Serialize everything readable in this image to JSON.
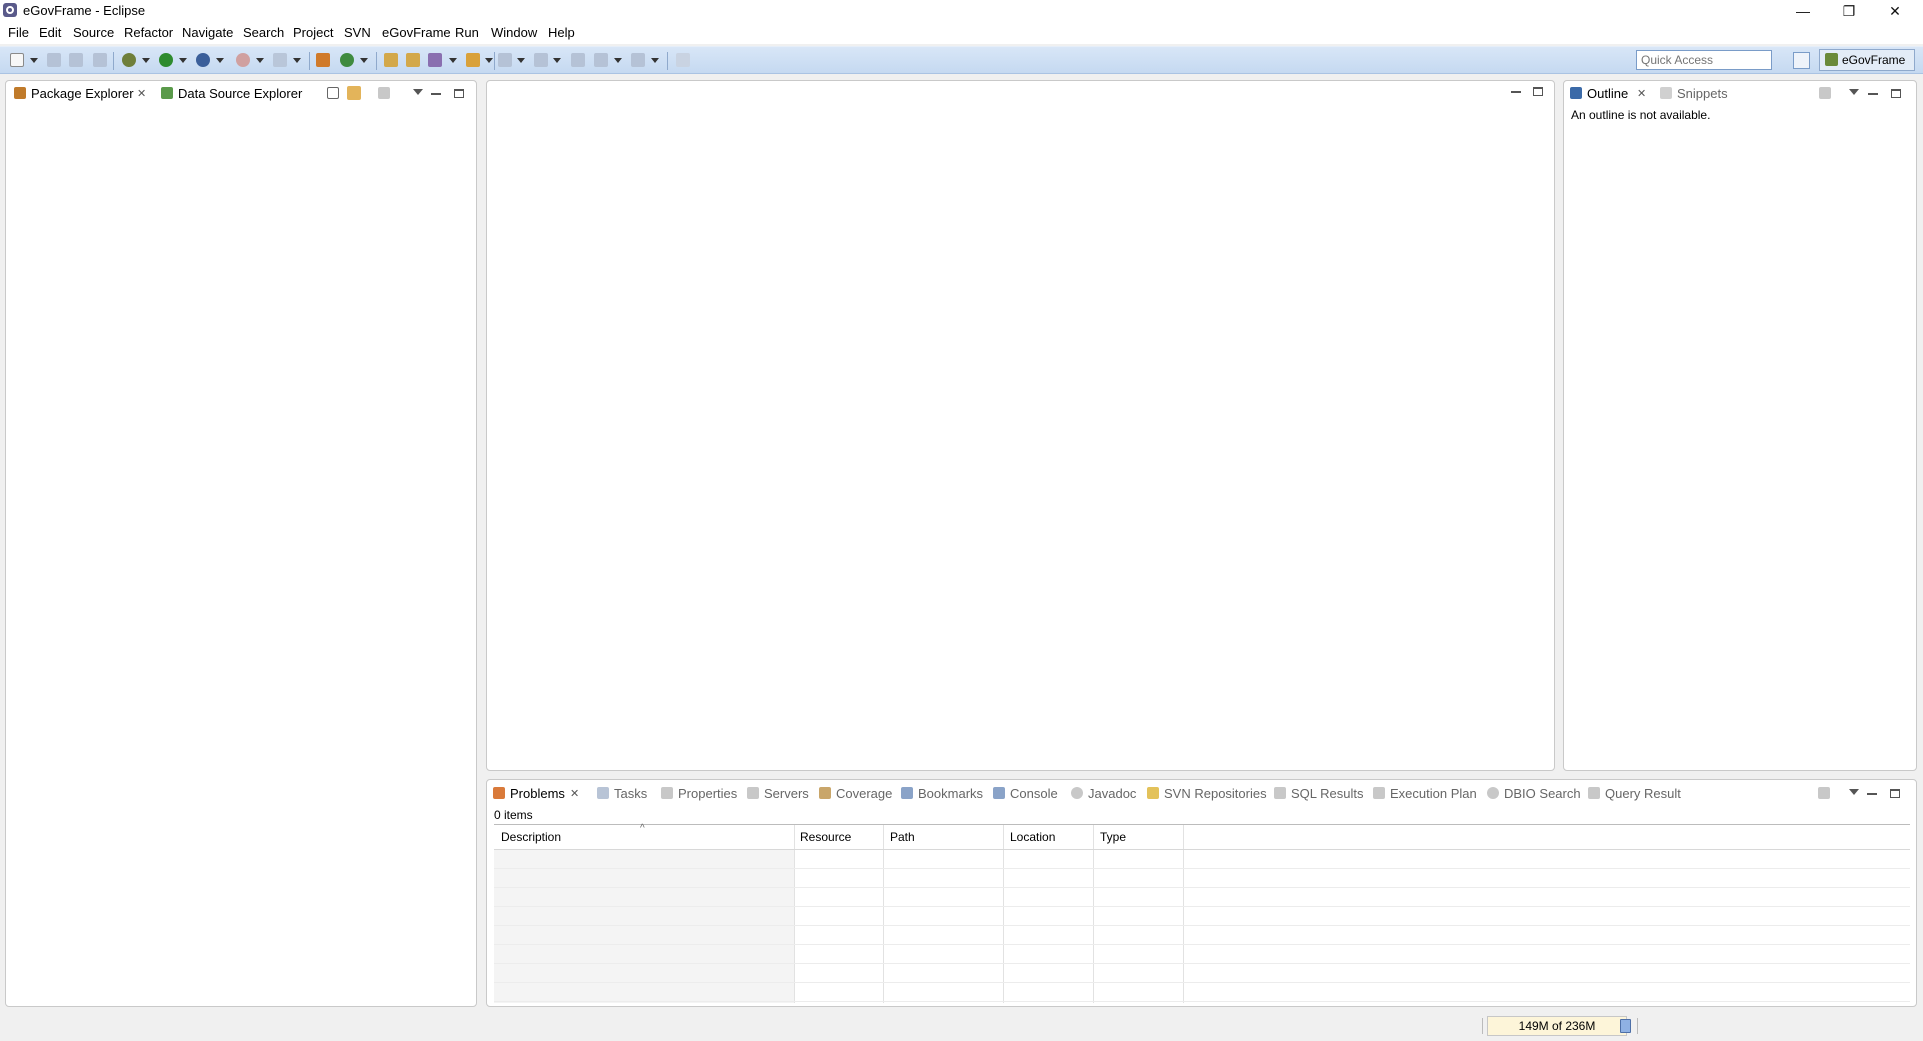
{
  "window": {
    "title": "eGovFrame - Eclipse",
    "controls": {
      "minimize": "—",
      "restore": "❐",
      "close": "✕"
    }
  },
  "menu": [
    "File",
    "Edit",
    "Source",
    "Refactor",
    "Navigate",
    "Search",
    "Project",
    "SVN",
    "eGovFrame",
    "Run",
    "Window",
    "Help"
  ],
  "toolbar": {
    "quick_access_placeholder": "Quick Access",
    "perspective_label": "eGovFrame"
  },
  "left_panel": {
    "tabs": [
      {
        "label": "Package Explorer",
        "icon": "package-explorer-icon",
        "active": true
      },
      {
        "label": "Data Source Explorer",
        "icon": "data-source-explorer-icon",
        "active": false
      }
    ]
  },
  "right_panel": {
    "tabs": [
      {
        "label": "Outline",
        "icon": "outline-icon",
        "active": true
      },
      {
        "label": "Snippets",
        "icon": "snippets-icon",
        "active": false
      }
    ],
    "message": "An outline is not available."
  },
  "bottom_panel": {
    "tabs": [
      {
        "label": "Problems",
        "icon": "problems-icon",
        "active": true
      },
      {
        "label": "Tasks",
        "icon": "tasks-icon"
      },
      {
        "label": "Properties",
        "icon": "properties-icon"
      },
      {
        "label": "Servers",
        "icon": "servers-icon"
      },
      {
        "label": "Coverage",
        "icon": "coverage-icon"
      },
      {
        "label": "Bookmarks",
        "icon": "bookmarks-icon"
      },
      {
        "label": "Console",
        "icon": "console-icon"
      },
      {
        "label": "Javadoc",
        "icon": "javadoc-icon"
      },
      {
        "label": "SVN Repositories",
        "icon": "svn-repositories-icon"
      },
      {
        "label": "SQL Results",
        "icon": "sql-results-icon"
      },
      {
        "label": "Execution Plan",
        "icon": "execution-plan-icon"
      },
      {
        "label": "DBIO Search",
        "icon": "dbio-search-icon"
      },
      {
        "label": "Query Result",
        "icon": "query-result-icon"
      }
    ],
    "items_count": "0 items",
    "columns": [
      "Description",
      "Resource",
      "Path",
      "Location",
      "Type"
    ]
  },
  "status": {
    "heap": "149M of 236M"
  },
  "colors": {
    "toolbar_bg": "#c5d9f1",
    "heap_bg": "#fdf5d9"
  }
}
